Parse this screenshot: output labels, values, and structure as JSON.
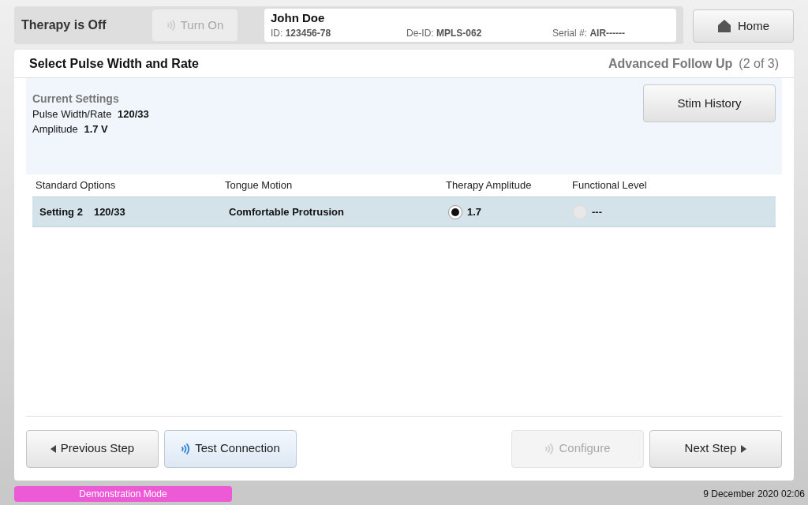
{
  "header": {
    "therapy_status": "Therapy is Off",
    "turn_on": {
      "label": "Turn On",
      "disabled": true
    },
    "patient": {
      "name": "John Doe",
      "id_label": "ID:",
      "id": "123456-78",
      "deid_label": "De-ID:",
      "deid": "MPLS-062",
      "serial_label": "Serial #:",
      "serial": "AIR------"
    },
    "home": "Home"
  },
  "page": {
    "title": "Select Pulse Width and Rate",
    "workflow": "Advanced Follow Up",
    "step": "(2 of 3)"
  },
  "current_settings": {
    "heading": "Current Settings",
    "rows": [
      {
        "label": "Pulse Width/Rate",
        "value": "120/33"
      },
      {
        "label": "Amplitude",
        "value": "1.7 V"
      }
    ],
    "stim_history": "Stim History"
  },
  "table": {
    "columns": [
      "Standard Options",
      "Tongue Motion",
      "Therapy Amplitude",
      "Functional Level"
    ],
    "rows": [
      {
        "setting": "Setting 2",
        "pulse": "120/33",
        "motion": "Comfortable Protrusion",
        "options": [
          {
            "label": "1.7",
            "selected": true,
            "disabled": false
          },
          {
            "label": "---",
            "selected": false,
            "disabled": true
          }
        ]
      }
    ]
  },
  "footer_buttons": [
    {
      "label": "Previous Step",
      "kind": "prev",
      "disabled": false
    },
    {
      "label": "Test Connection",
      "kind": "wireless",
      "disabled": false
    },
    {
      "label": "Configure",
      "kind": "wireless",
      "disabled": true
    },
    {
      "label": "Next Step",
      "kind": "next",
      "disabled": false
    }
  ],
  "status_bar": {
    "mode": "Demonstration Mode",
    "datetime": "9 December 2020 02:06"
  }
}
